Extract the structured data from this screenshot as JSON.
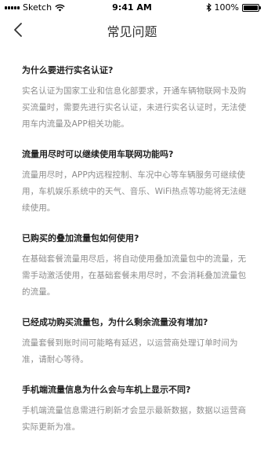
{
  "status_bar": {
    "carrier": "Sketch",
    "time": "9:41 AM",
    "battery": "100%"
  },
  "nav": {
    "title": "常见问题"
  },
  "faq": [
    {
      "question": "为什么要进行实名认证?",
      "answer": "实名认证为国家工业和信息化部要求，开通车辆物联网卡及购买流量时，需要先进行实名认证，未进行实名认证时，无法使用车内流量及APP相关功能。"
    },
    {
      "question": "流量用尽时可以继续使用车联网功能吗?",
      "answer": "流量用尽时，APP内远程控制、车况中心等车辆服务可继续使用，车机娱乐系统中的天气、音乐、WiFi热点等功能将无法继续使用。"
    },
    {
      "question": "已购买的叠加流量包如何使用?",
      "answer": "在基础套餐流量用尽后，将自动使用叠加流量包中的流量，无需手动激活使用，在基础套餐未用尽时，不会消耗叠加流量包的流量。"
    },
    {
      "question": "已经成功购买流量包，为什么剩余流量没有增加?",
      "answer": "流量套餐到账时间可能略有延迟，以运营商处理订单时间为准，请耐心等待。"
    },
    {
      "question": "手机端流量信息为什么会与车机上显示不同?",
      "answer": "手机端流量信息需进行刷新才会显示最新数据，数据以运营商实际更新为准。"
    }
  ]
}
